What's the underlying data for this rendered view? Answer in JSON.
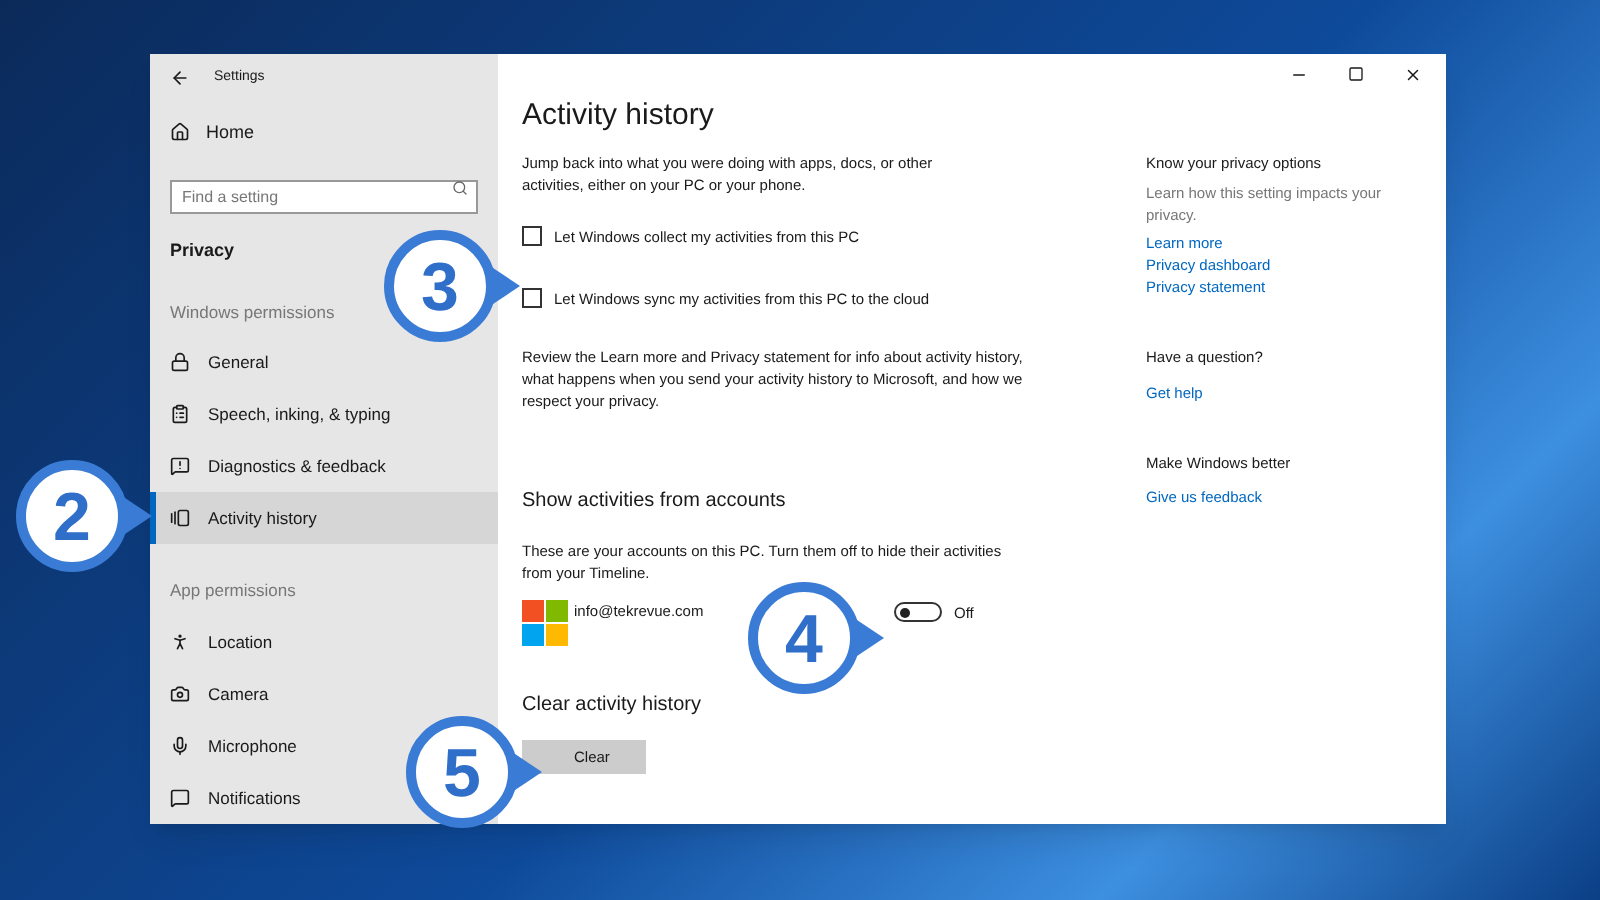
{
  "window": {
    "title": "Settings"
  },
  "sidebar": {
    "home": "Home",
    "search": {
      "placeholder": "Find a setting"
    },
    "section_title": "Privacy",
    "groups": [
      {
        "heading": "Windows permissions",
        "items": [
          {
            "label": "General",
            "selected": false
          },
          {
            "label": "Speech, inking, & typing",
            "selected": false
          },
          {
            "label": "Diagnostics & feedback",
            "selected": false
          },
          {
            "label": "Activity history",
            "selected": true
          }
        ]
      },
      {
        "heading": "App permissions",
        "items": [
          {
            "label": "Location",
            "selected": false
          },
          {
            "label": "Camera",
            "selected": false
          },
          {
            "label": "Microphone",
            "selected": false
          },
          {
            "label": "Notifications",
            "selected": false
          }
        ]
      }
    ]
  },
  "main": {
    "title": "Activity history",
    "intro": "Jump back into what you were doing with apps, docs, or other activities, either on your PC or your phone.",
    "checkboxes": [
      {
        "label": "Let Windows collect my activities from this PC",
        "checked": false
      },
      {
        "label": "Let Windows sync my activities from this PC to the cloud",
        "checked": false
      }
    ],
    "review": "Review the Learn more and Privacy statement for info about activity history, what happens when you send your activity history to Microsoft, and how we respect your privacy.",
    "accounts": {
      "title": "Show activities from accounts",
      "description": "These are your accounts on this PC. Turn them off to hide their activities from your Timeline.",
      "items": [
        {
          "email": "info@tekrevue.com",
          "on": false,
          "state_label": "Off"
        }
      ]
    },
    "clear": {
      "title": "Clear activity history",
      "button": "Clear"
    }
  },
  "aside": [
    {
      "title": "Know your privacy options",
      "text": "Learn how this setting impacts your privacy.",
      "links": [
        "Learn more",
        "Privacy dashboard",
        "Privacy statement"
      ]
    },
    {
      "title": "Have a question?",
      "links": [
        "Get help"
      ]
    },
    {
      "title": "Make Windows better",
      "links": [
        "Give us feedback"
      ]
    }
  ],
  "callouts": [
    {
      "number": "2"
    },
    {
      "number": "3"
    },
    {
      "number": "4"
    },
    {
      "number": "5"
    }
  ]
}
